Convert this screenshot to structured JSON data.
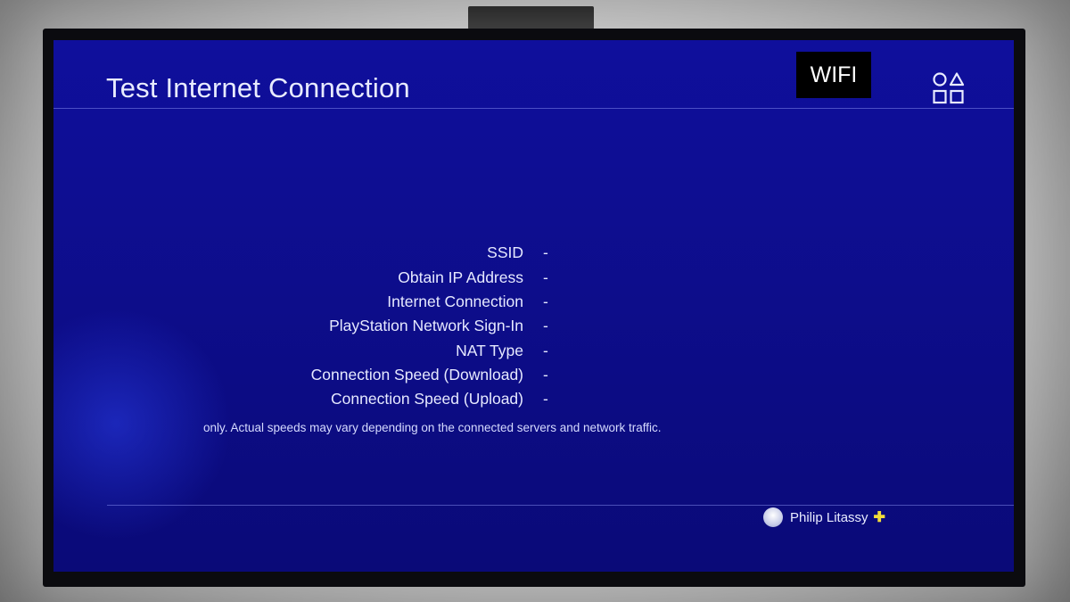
{
  "screen": {
    "title": "Test Internet Connection",
    "badge": "WIFI",
    "menu_icon": "playstation-shapes-icon"
  },
  "results": [
    {
      "label": "SSID",
      "value": "-"
    },
    {
      "label": "Obtain IP Address",
      "value": "-"
    },
    {
      "label": "Internet Connection",
      "value": "-"
    },
    {
      "label": "PlayStation Network Sign-In",
      "value": "-"
    },
    {
      "label": "NAT Type",
      "value": "-"
    },
    {
      "label": "Connection Speed (Download)",
      "value": "-"
    },
    {
      "label": "Connection Speed (Upload)",
      "value": "-"
    }
  ],
  "disclaimer": "only. Actual speeds may vary depending on the connected servers and network traffic.",
  "user": {
    "name": "Philip Litassy",
    "avatar_icon": "user-avatar-icon",
    "plus_icon": "playstation-plus-icon"
  },
  "colors": {
    "screen_bg": "#0f0f9c",
    "text": "#e6e9ff",
    "plus": "#f2dc3a"
  }
}
